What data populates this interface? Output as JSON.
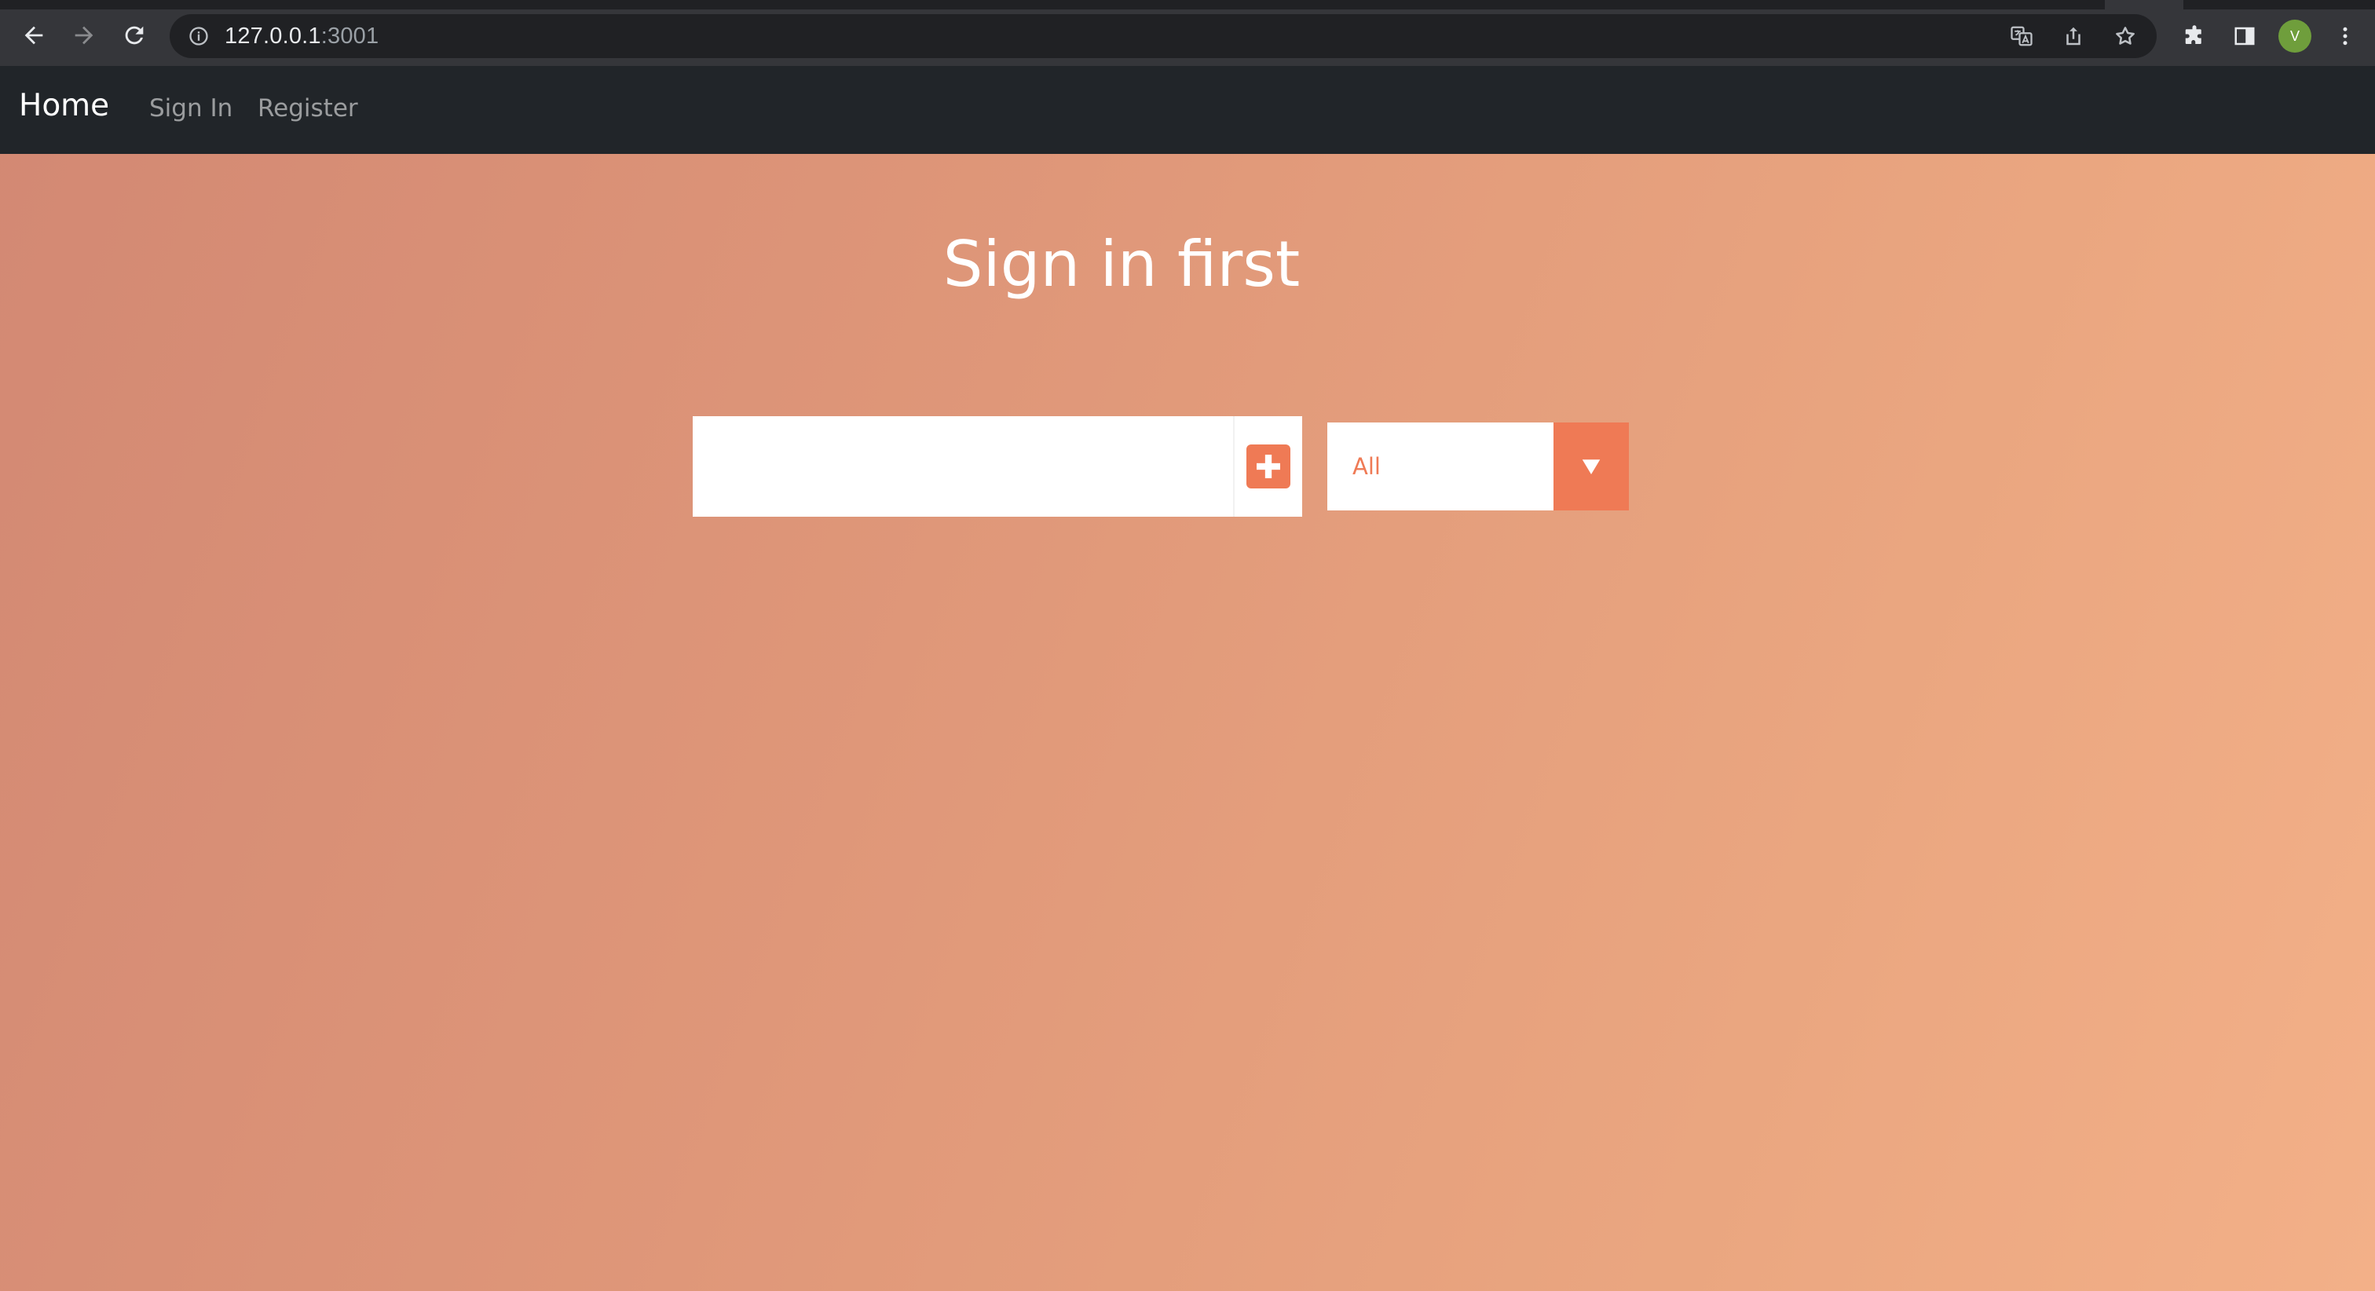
{
  "browser": {
    "url_host": "127.0.0.1",
    "url_port": ":3001",
    "avatar_letter": "V"
  },
  "navbar": {
    "brand": "Home",
    "links": [
      "Sign In",
      "Register"
    ]
  },
  "main": {
    "title": "Sign in first",
    "todo_input_placeholder": "",
    "filter_selected": "All"
  },
  "colors": {
    "accent": "#ef7a55",
    "navbar_bg": "#212529",
    "gradient_start": "#d28873",
    "gradient_end": "#f3b088"
  },
  "icons": {
    "back": "arrow-left-icon",
    "forward": "arrow-right-icon",
    "reload": "reload-icon",
    "info": "info-icon",
    "translate": "translate-icon",
    "share": "share-icon",
    "bookmark": "star-icon",
    "extensions": "puzzle-icon",
    "side_panel": "side-panel-icon",
    "menu": "kebab-menu-icon",
    "add": "plus-icon",
    "dropdown": "caret-down-icon"
  }
}
